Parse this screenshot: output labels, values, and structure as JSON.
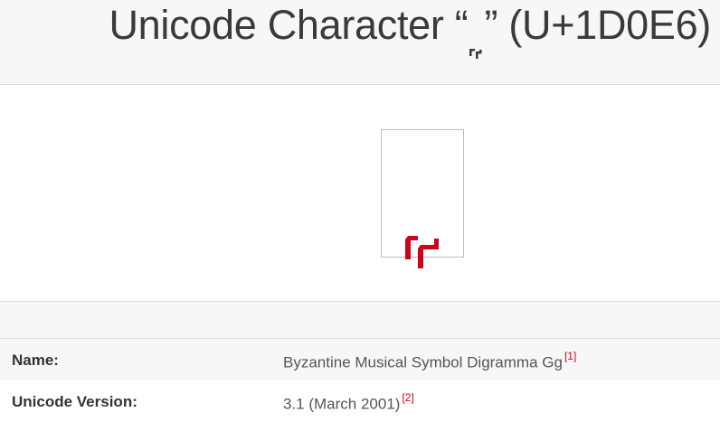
{
  "header": {
    "title_prefix": "Unicode Character “",
    "title_suffix": "” (U+1D0E6)"
  },
  "glyph": {
    "name": "byzantine-digramma-gg",
    "color": "#d0021b"
  },
  "properties": [
    {
      "label": "Name:",
      "value": "Byzantine Musical Symbol Digramma Gg",
      "ref": "[1]"
    },
    {
      "label": "Unicode Version:",
      "value": "3.1 (March 2001)",
      "ref": "[2]"
    }
  ],
  "colors": {
    "header_bg": "#f7f7f7",
    "accent": "#d0021b",
    "border": "#dddddd"
  }
}
